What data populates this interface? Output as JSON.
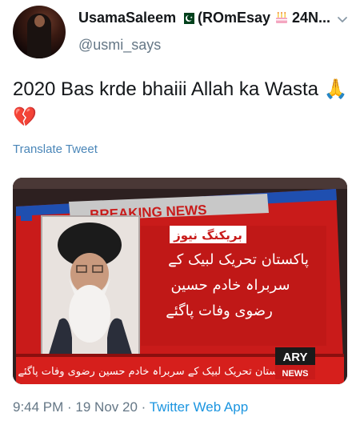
{
  "tweet": {
    "display_name": "UsamaSaleem",
    "name_suffix": "(ROmEsay",
    "name_tail": "24N...",
    "handle": "@usmi_says",
    "text": "2020 Bas krde bhaiii Allah ka Wasta 🙏💔",
    "translate_label": "Translate Tweet",
    "timestamp": "9:44 PM · 19 Nov 20 · ",
    "source_app": "Twitter Web App"
  },
  "media": {
    "breaking_label": "BREAKING NEWS",
    "urdu_title": "بریکنگ نیوز",
    "urdu_line1": "پاکستان تحریک لبیک کے",
    "urdu_line2": "سربراہ خادم حسین",
    "urdu_line3": "رضوی وفات پاگئے",
    "ticker": "پاکستان تحریک لبیک کے سربراہ خادم حسین رضوی وفات پاگئے",
    "logo_top": "ARY",
    "logo_bottom": "NEWS"
  },
  "icons": {
    "flag": "pakistan-flag-icon",
    "cake": "birthday-cake-icon",
    "chevron": "chevron-down-icon"
  },
  "colors": {
    "link": "#1b95e0",
    "muted": "#657786",
    "news_red": "#d9201c"
  }
}
